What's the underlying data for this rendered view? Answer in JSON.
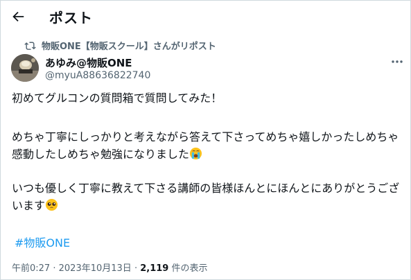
{
  "header": {
    "title": "ポスト",
    "back_icon": "arrow-left-icon"
  },
  "repost": {
    "icon": "repost-icon",
    "text": "物販ONE【物販スクール】さんがリポスト"
  },
  "author": {
    "name": "あゆみ@物販ONE",
    "handle": "@myuA88636822740",
    "more_icon": "more-dots-icon"
  },
  "tweet": {
    "paragraph1": "初めてグルコンの質問箱で質問してみた！",
    "paragraph2": "めちゃ丁寧にしっかりと考えながら答えて下さってめちゃ嬉しかったしめちゃ感動したしめちゃ勉強になりました",
    "paragraph2_emoji": "loudly-crying-face-emoji",
    "paragraph3": "いつも優しく丁寧に教えて下さる講師の皆様ほんとにほんとにありがとうございます",
    "paragraph3_emoji": "pleading-face-emoji",
    "hashtag": "#物販ONE"
  },
  "meta": {
    "time": "午前0:27",
    "separator1": "·",
    "date": "2023年10月13日",
    "separator2": "·",
    "views": "2,119",
    "views_label": "件の表示"
  },
  "colors": {
    "link": "#1d9bf0",
    "secondary_text": "#536471",
    "primary_text": "#0f1419",
    "border": "#cfd9de"
  }
}
